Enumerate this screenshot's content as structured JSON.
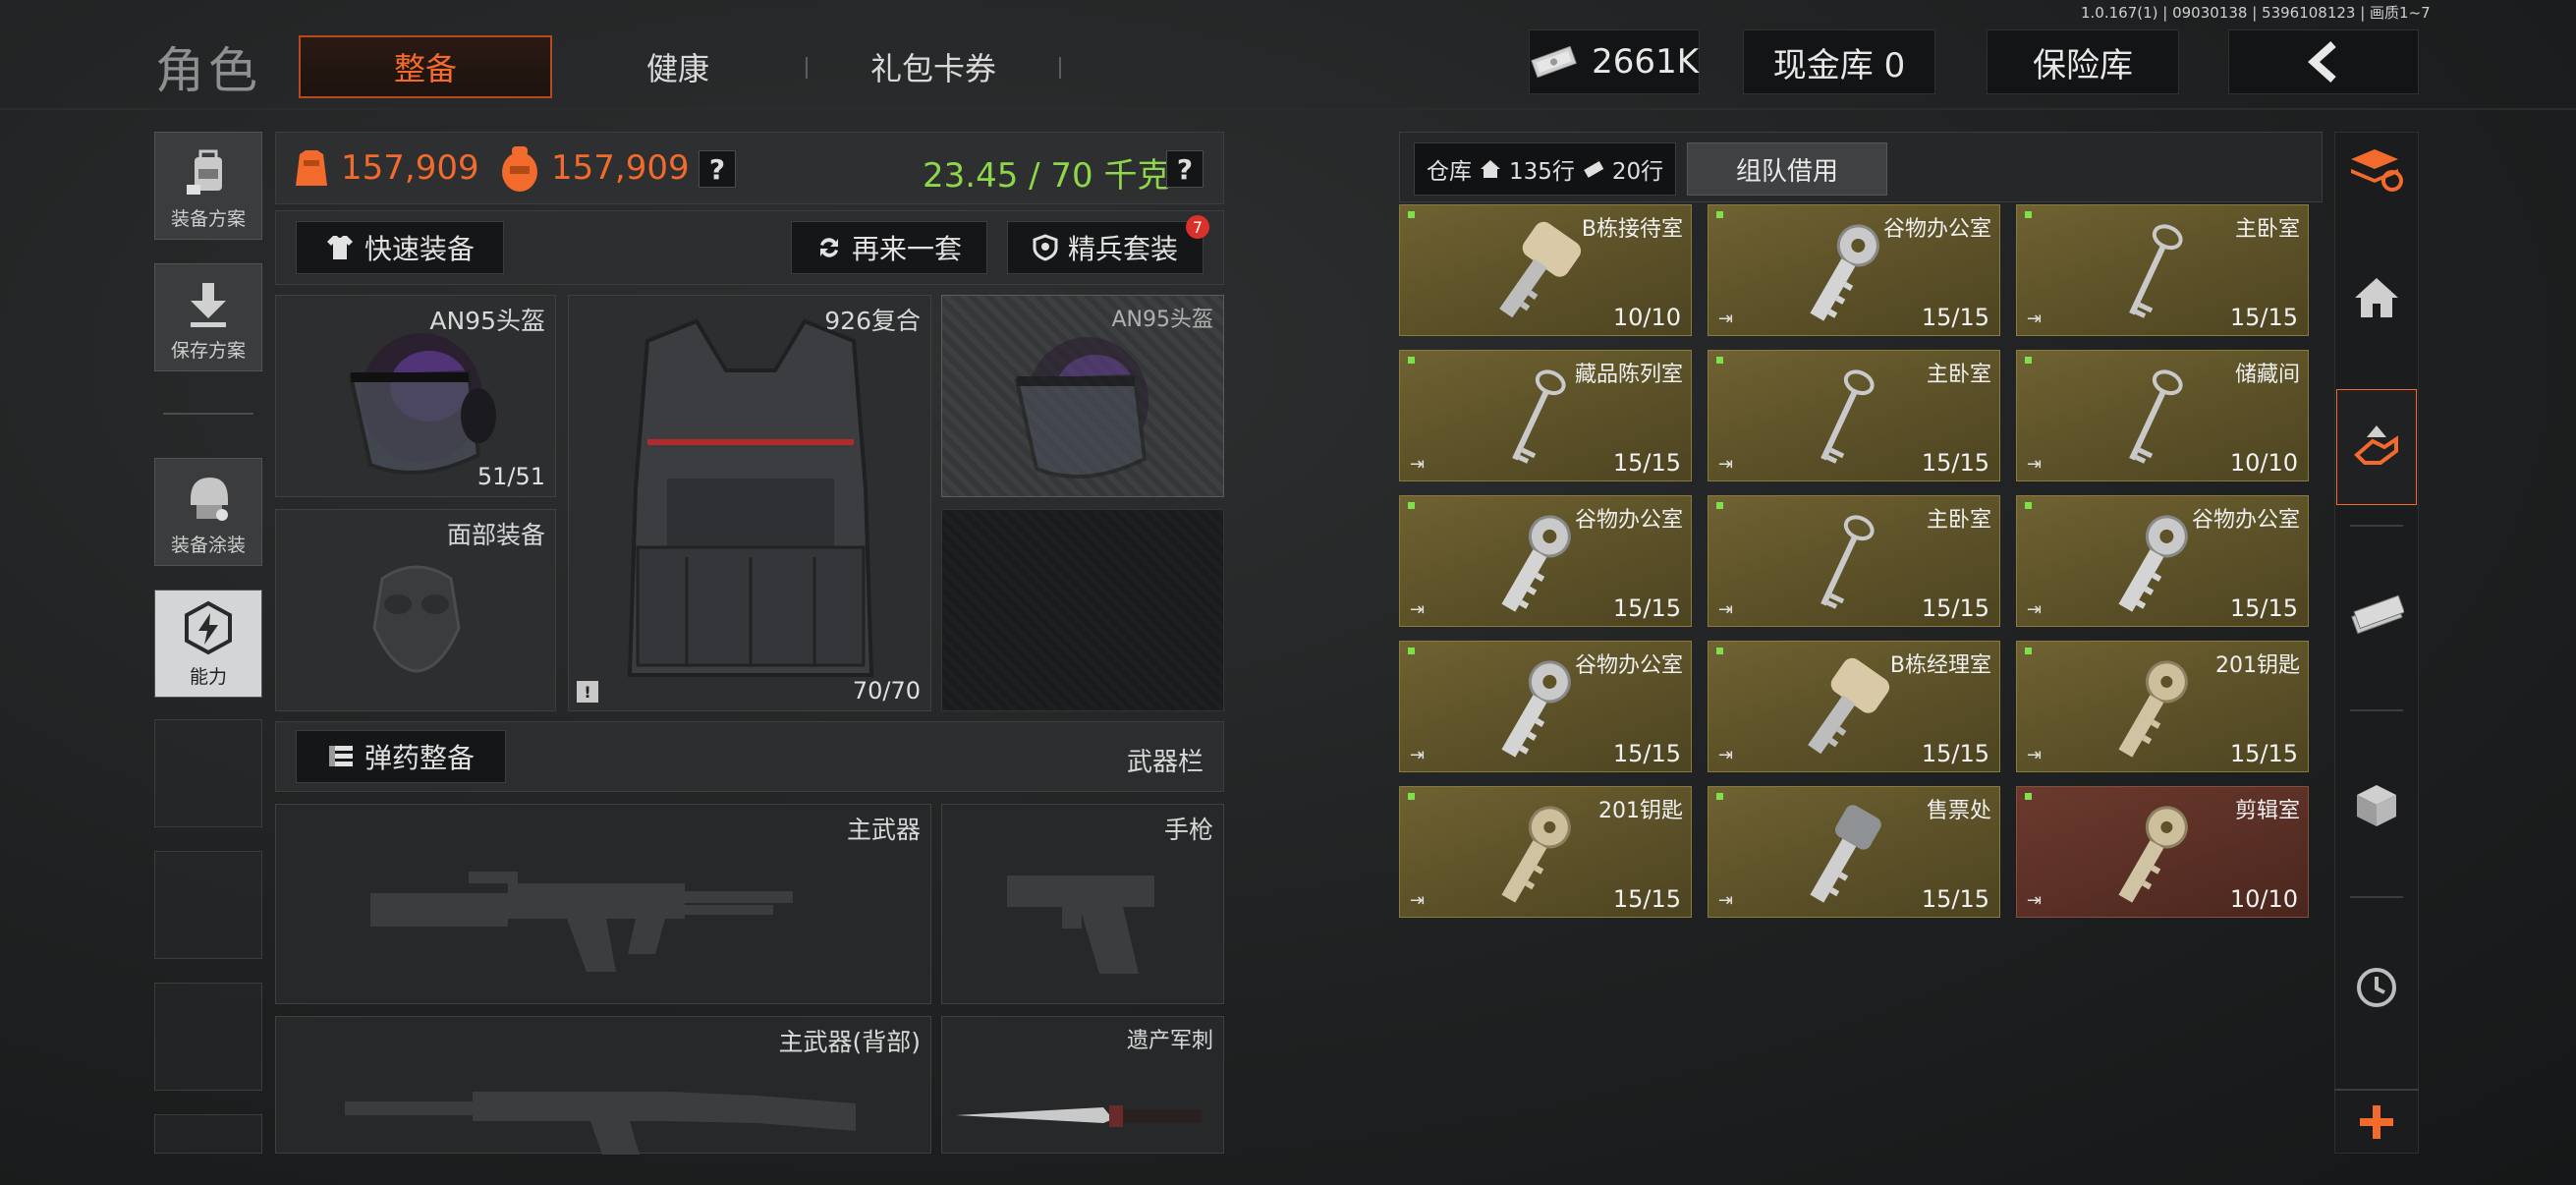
{
  "version": "1.0.167(1) | 09030138 | 5396108123 | 画质1~7",
  "header": {
    "title": "角色",
    "tabs": [
      {
        "label": "整备",
        "active": true
      },
      {
        "label": "健康",
        "active": false
      },
      {
        "label": "礼包卡券",
        "active": false
      }
    ],
    "money": "2661K",
    "cash_vault": "现金库 0",
    "insurance": "保险库"
  },
  "sidebar": {
    "items": [
      {
        "label": "装备方案",
        "icon": "backpack-plan-icon"
      },
      {
        "label": "保存方案",
        "icon": "download-icon"
      },
      {
        "label": "装备涂装",
        "icon": "helmet-paint-icon"
      },
      {
        "label": "能力",
        "icon": "ability-icon",
        "active": true
      }
    ]
  },
  "stats": {
    "value1": "157,909",
    "value2": "157,909",
    "weight": "23.45 / 70 千克",
    "help": "?"
  },
  "toolbar": {
    "quick_equip": "快速装备",
    "again": "再来一套",
    "elite": "精兵套装",
    "elite_badge": "7"
  },
  "slots": {
    "helmet": {
      "label": "AN95头盔",
      "count": "51/51"
    },
    "armor": {
      "label": "926复合",
      "count": "70/70"
    },
    "helmet_preview": {
      "label": "AN95头盔"
    },
    "face": {
      "label": "面部装备"
    }
  },
  "ammo": {
    "label": "弹药整备",
    "weapons_bar": "武器栏"
  },
  "weapons": {
    "primary": "主武器",
    "pistol": "手枪",
    "primary_back": "主武器(背部)",
    "melee": "遗产军刺"
  },
  "warehouse": {
    "label": "仓库",
    "rows": "135行",
    "rows2": "20行",
    "team_borrow": "组队借用"
  },
  "keys": [
    {
      "name": "B栋接待室",
      "count": "10/10",
      "style": "tan"
    },
    {
      "name": "谷物办公室",
      "count": "15/15",
      "style": "silver"
    },
    {
      "name": "主卧室",
      "count": "15/15",
      "style": "skeleton"
    },
    {
      "name": "藏品陈列室",
      "count": "15/15",
      "style": "skeleton"
    },
    {
      "name": "主卧室",
      "count": "15/15",
      "style": "skeleton"
    },
    {
      "name": "储藏间",
      "count": "10/10",
      "style": "skeleton"
    },
    {
      "name": "谷物办公室",
      "count": "15/15",
      "style": "silver"
    },
    {
      "name": "主卧室",
      "count": "15/15",
      "style": "skeleton"
    },
    {
      "name": "谷物办公室",
      "count": "15/15",
      "style": "silver"
    },
    {
      "name": "谷物办公室",
      "count": "15/15",
      "style": "silver"
    },
    {
      "name": "B栋经理室",
      "count": "15/15",
      "style": "tan"
    },
    {
      "name": "201钥匙",
      "count": "15/15",
      "style": "brass"
    },
    {
      "name": "201钥匙",
      "count": "15/15",
      "style": "brass"
    },
    {
      "name": "售票处",
      "count": "15/15",
      "style": "gray"
    },
    {
      "name": "剪辑室",
      "count": "10/10",
      "style": "brass",
      "red": true
    }
  ],
  "right_sidebar": [
    "refresh-layers-icon",
    "home-icon",
    "hand-transfer-icon",
    "cash-icon",
    "box-icon",
    "clock-icon",
    "plus-icon"
  ]
}
